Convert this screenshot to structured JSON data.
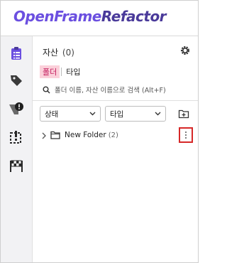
{
  "app": {
    "logo_part1": "OpenFrame",
    "logo_part2": "Refactor",
    "accent": "#6b4fe0"
  },
  "rail": {
    "items": [
      {
        "icon": "clipboard-list-icon",
        "active": true
      },
      {
        "icon": "tag-icon",
        "active": false
      },
      {
        "icon": "alert-shape-icon",
        "active": false
      },
      {
        "icon": "dashed-alert-icon",
        "active": false
      },
      {
        "icon": "checkered-flag-icon",
        "active": false
      }
    ]
  },
  "panel": {
    "title": "자산",
    "count": "(0)",
    "tabs": [
      {
        "label": "폴더",
        "active": true
      },
      {
        "label": "타입",
        "active": false
      }
    ],
    "search_placeholder": "폴더 이름, 자산 이름으로 검색 (Alt+F)",
    "filters": {
      "status_label": "상태",
      "type_label": "타입"
    },
    "tree": [
      {
        "name": "New Folder",
        "count": "(2)"
      }
    ]
  }
}
